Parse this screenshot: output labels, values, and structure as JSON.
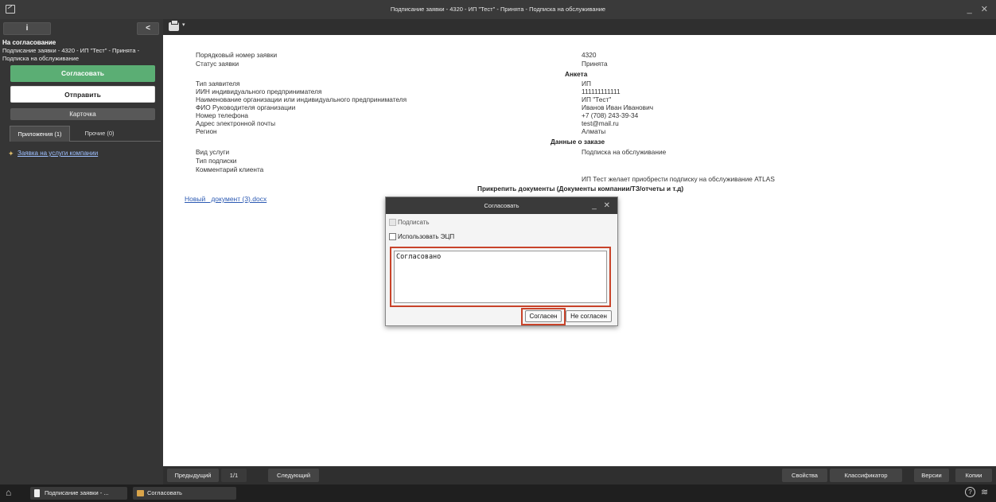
{
  "window": {
    "title": "Подписание заявки - 4320 - ИП \"Тест\" - Принята - Подписка на обслуживание",
    "controls": "_ ✕"
  },
  "sidebar": {
    "info_label": "i",
    "back_label": "<",
    "status_title": "На согласование",
    "status_sub": "Подписание заявки - 4320 - ИП \"Тест\" - Принята - Подписка на обслуживание",
    "approve_button": "Согласовать",
    "send_button": "Отправить",
    "card_button": "Карточка",
    "tabs": [
      {
        "label": "Приложения (1)"
      },
      {
        "label": "Прочие (0)"
      }
    ],
    "attachments": [
      {
        "label": "Заявка на услуги компании"
      }
    ]
  },
  "toolbar": {
    "caret": "▾"
  },
  "form": {
    "rows1": [
      {
        "label": "Порядковый номер заявки",
        "value": "4320"
      },
      {
        "label": "Статус заявки",
        "value": "Принята"
      }
    ],
    "section_anketa": "Анкета",
    "rows2": [
      {
        "label": "Тип заявителя",
        "value": "ИП"
      },
      {
        "label": "ИИН индивидуального предпринимателя",
        "value": "111111111111"
      },
      {
        "label": "Наименование организации или индивидуального предпринимателя",
        "value": "ИП \"Тест\""
      },
      {
        "label": "ФИО Руководителя организации",
        "value": "Иванов Иван Иванович"
      },
      {
        "label": "Номер телефона",
        "value": "+7 (708) 243-39-34"
      },
      {
        "label": "Адрес электронной почты",
        "value": "test@mail.ru"
      },
      {
        "label": "Регион",
        "value": "Алматы"
      }
    ],
    "section_order": "Данные о заказе",
    "rows3": [
      {
        "label": "Вид услуги",
        "value": "Подписка на обслуживание"
      },
      {
        "label": "Тип подписки",
        "value": ""
      },
      {
        "label": "Комментарий клиента",
        "value": "ИП Тест желает приобрести подписку на обслуживание ATLAS"
      }
    ],
    "section_docs": "Прикрепить документы (Документы компании/ТЗ/отчеты и т.д)",
    "doc_link": "Новый_ документ (3).docx"
  },
  "dialog": {
    "title": "Согласовать",
    "controls": "_ ✕",
    "sign_label": "Подписать",
    "eds_label": "Использовать ЭЦП",
    "comment_value": "Согласовано",
    "agree_button": "Согласен",
    "disagree_button": "Не согласен"
  },
  "bottom_nav": {
    "prev": "Предыдущий",
    "page": "1/1",
    "next": "Следующий",
    "properties": "Свойства",
    "classifier": "Классификатор",
    "versions": "Версии",
    "copies": "Копии"
  },
  "taskbar": {
    "items": [
      {
        "label": "Подписание заявки - ..."
      },
      {
        "label": "Согласовать"
      }
    ]
  }
}
